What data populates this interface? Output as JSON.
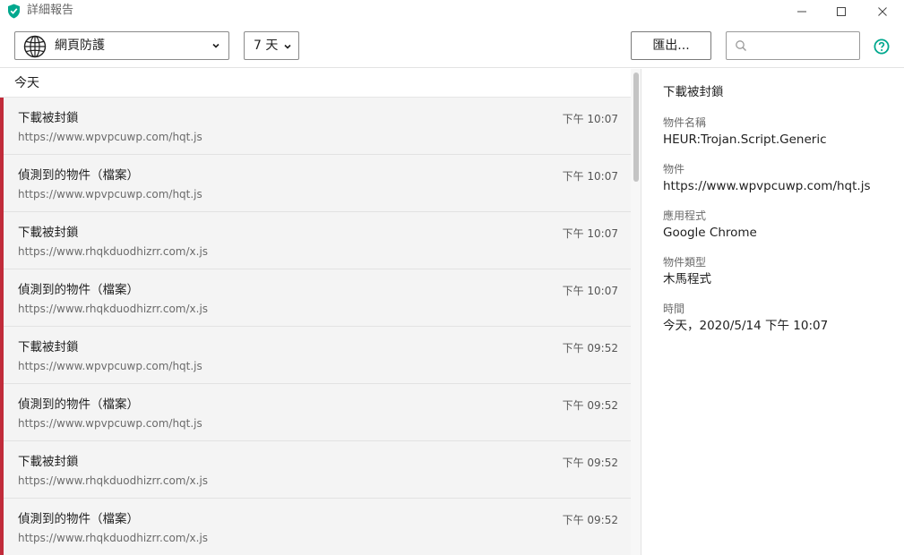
{
  "window": {
    "title": "詳細報告",
    "colors": {
      "accent": "#00a88e",
      "marker": "#c12b3a"
    }
  },
  "toolbar": {
    "component_select": {
      "selected": "網頁防護",
      "icon": "globe-icon"
    },
    "period_select": {
      "selected": "7 天"
    },
    "export_label": "匯出...",
    "search": {
      "placeholder": "",
      "value": ""
    },
    "help_icon": "help-icon"
  },
  "list": {
    "group_label": "今天",
    "rows": [
      {
        "title": "下載被封鎖",
        "url": "https://www.wpvpcuwp.com/hqt.js",
        "time": "下午 10:07"
      },
      {
        "title": "偵測到的物件（檔案）",
        "url": "https://www.wpvpcuwp.com/hqt.js",
        "time": "下午 10:07"
      },
      {
        "title": "下載被封鎖",
        "url": "https://www.rhqkduodhizrr.com/x.js",
        "time": "下午 10:07"
      },
      {
        "title": "偵測到的物件（檔案）",
        "url": "https://www.rhqkduodhizrr.com/x.js",
        "time": "下午 10:07"
      },
      {
        "title": "下載被封鎖",
        "url": "https://www.wpvpcuwp.com/hqt.js",
        "time": "下午 09:52"
      },
      {
        "title": "偵測到的物件（檔案）",
        "url": "https://www.wpvpcuwp.com/hqt.js",
        "time": "下午 09:52"
      },
      {
        "title": "下載被封鎖",
        "url": "https://www.rhqkduodhizrr.com/x.js",
        "time": "下午 09:52"
      },
      {
        "title": "偵測到的物件（檔案）",
        "url": "https://www.rhqkduodhizrr.com/x.js",
        "time": "下午 09:52"
      }
    ]
  },
  "details": {
    "title": "下載被封鎖",
    "fields": [
      {
        "label": "物件名稱",
        "value": "HEUR:Trojan.Script.Generic"
      },
      {
        "label": "物件",
        "value": "https://www.wpvpcuwp.com/hqt.js"
      },
      {
        "label": "應用程式",
        "value": "Google Chrome"
      },
      {
        "label": "物件類型",
        "value": "木馬程式"
      },
      {
        "label": "時間",
        "value": "今天，2020/5/14 下午 10:07"
      }
    ]
  }
}
